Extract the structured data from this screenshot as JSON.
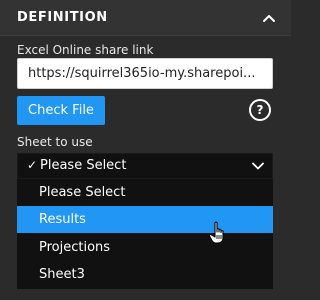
{
  "definition": {
    "title": "DEFINITION",
    "collapse_icon": "chevron-up-icon"
  },
  "share_link": {
    "label": "Excel Online share link",
    "value": "https://squirrel365io-my.sharepoi..."
  },
  "check_file": {
    "label": "Check File",
    "help_glyph": "?",
    "help_icon": "question-circle-icon"
  },
  "sheet": {
    "label": "Sheet to use",
    "checkmark": "✓",
    "selected_value": "Please Select",
    "chevron_icon": "chevron-down-icon",
    "options": [
      {
        "label": "Please Select"
      },
      {
        "label": "Results"
      },
      {
        "label": "Projections"
      },
      {
        "label": "Sheet3"
      }
    ],
    "highlighted_option": "Results"
  },
  "colors": {
    "accent": "#2196f3",
    "panel_bg": "#2b2b2b",
    "dropdown_bg": "#111111"
  }
}
